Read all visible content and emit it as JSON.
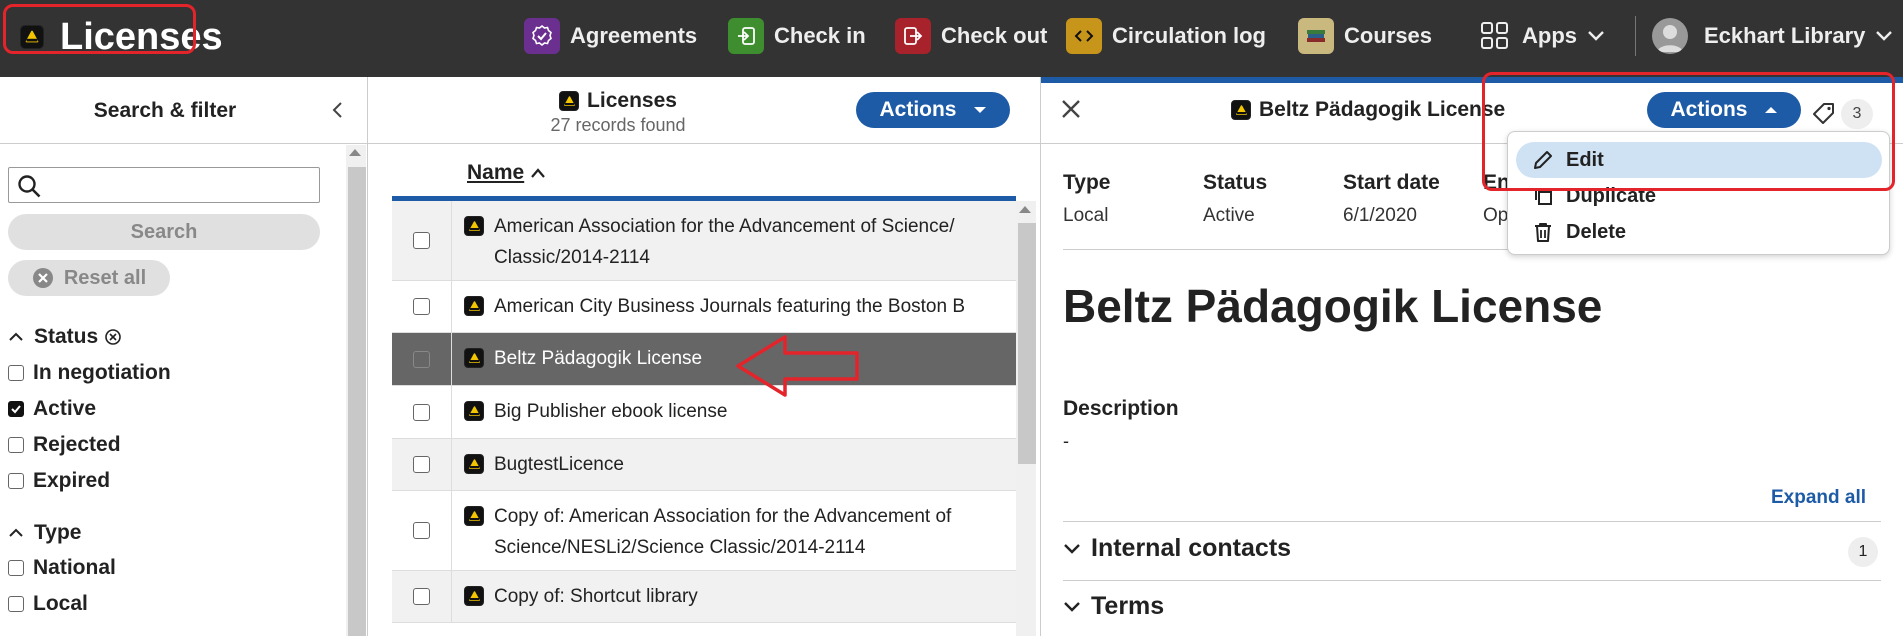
{
  "app": {
    "title": "Licenses"
  },
  "nav": {
    "items": [
      {
        "label": "Agreements",
        "icon": "agreements-icon",
        "color": "#6b2f8f"
      },
      {
        "label": "Check in",
        "icon": "check-in-icon",
        "color": "#3e8e30"
      },
      {
        "label": "Check out",
        "icon": "check-out-icon",
        "color": "#a8222b"
      },
      {
        "label": "Circulation log",
        "icon": "circulation-log-icon",
        "color": "#c8951b"
      },
      {
        "label": "Courses",
        "icon": "courses-icon",
        "color": "#c9b97e"
      },
      {
        "label": "Apps",
        "icon": "apps-grid-icon"
      }
    ],
    "user": "Eckhart Library"
  },
  "filter": {
    "title": "Search & filter",
    "search_placeholder": "",
    "search_button": "Search",
    "reset_button": "Reset all",
    "status": {
      "heading": "Status",
      "options": [
        {
          "label": "In negotiation",
          "checked": false
        },
        {
          "label": "Active",
          "checked": true
        },
        {
          "label": "Rejected",
          "checked": false
        },
        {
          "label": "Expired",
          "checked": false
        }
      ]
    },
    "type": {
      "heading": "Type",
      "options": [
        {
          "label": "National",
          "checked": false
        },
        {
          "label": "Local",
          "checked": false
        }
      ]
    }
  },
  "results": {
    "title": "Licenses",
    "count": "27 records found",
    "actions_label": "Actions",
    "column_name": "Name",
    "rows": [
      {
        "name": "American Association for the Advancement of Science/ Classic/2014-2114",
        "selected": false
      },
      {
        "name": "American City Business Journals featuring the Boston B",
        "selected": false
      },
      {
        "name": "Beltz Pädagogik License",
        "selected": true
      },
      {
        "name": "Big Publisher ebook license",
        "selected": false
      },
      {
        "name": "BugtestLicence",
        "selected": false
      },
      {
        "name": "Copy of: American Association for the Advancement of Science/NESLi2/Science Classic/2014-2114",
        "selected": false
      },
      {
        "name": "Copy of: Shortcut library",
        "selected": false
      }
    ]
  },
  "detail": {
    "title": "Beltz Pädagogik License",
    "actions_label": "Actions",
    "tag_count": "3",
    "fields": [
      {
        "key": "Type",
        "value": "Local"
      },
      {
        "key": "Status",
        "value": "Active"
      },
      {
        "key": "Start date",
        "value": "6/1/2020"
      },
      {
        "key": "En",
        "value": "Op"
      }
    ],
    "heading": "Beltz Pädagogik License",
    "description_label": "Description",
    "description_value": "-",
    "expand_all": "Expand all",
    "sections": [
      {
        "label": "Internal contacts",
        "count": "1"
      },
      {
        "label": "Terms",
        "count": ""
      }
    ]
  },
  "menu": {
    "items": [
      {
        "label": "Edit",
        "icon": "pencil-icon"
      },
      {
        "label": "Duplicate",
        "icon": "duplicate-icon"
      },
      {
        "label": "Delete",
        "icon": "trash-icon"
      }
    ]
  }
}
